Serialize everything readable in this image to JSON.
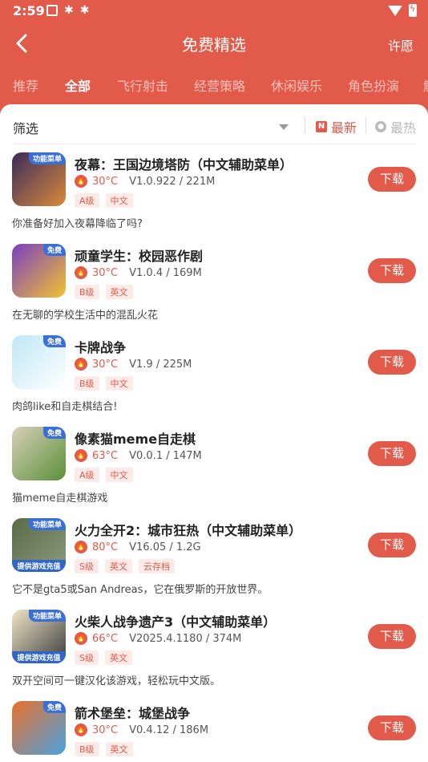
{
  "status_bar": {
    "time": "2:59"
  },
  "header": {
    "title": "免费精选",
    "wish_label": "许愿"
  },
  "tabs": [
    "推荐",
    "全部",
    "飞行射击",
    "经营策略",
    "休闲娱乐",
    "角色扮演",
    "解"
  ],
  "active_tab": "全部",
  "filter": {
    "label": "筛选",
    "sort_latest": "最新",
    "sort_hot": "最热"
  },
  "download_label": "下载",
  "games": [
    {
      "title": "夜幕：王国边境塔防（中文辅助菜单）",
      "temp": "30°C",
      "version": "V1.0.922 / 221M",
      "tags": [
        "A级",
        "中文"
      ],
      "desc": "你准备好加入夜幕降临了吗?",
      "badge": "功能菜单",
      "badge_bottom": "",
      "icon": "night-defense-icon",
      "colors": [
        "#3b2a5c",
        "#d98a3a"
      ]
    },
    {
      "title": "顽童学生：校园恶作剧",
      "temp": "30°C",
      "version": "V1.0.4 / 169M",
      "tags": [
        "B级",
        "英文"
      ],
      "desc": "在无聊的学校生活中的混乱火花",
      "badge": "免费",
      "badge_bottom": "",
      "icon": "prank-student-icon",
      "colors": [
        "#7a3fc2",
        "#f2c230"
      ]
    },
    {
      "title": "卡牌战争",
      "temp": "30°C",
      "version": "V1.9 / 225M",
      "tags": [
        "B级",
        "中文"
      ],
      "desc": "肉鸽like和自走棋结合!",
      "badge": "免费",
      "badge_bottom": "",
      "icon": "card-war-icon",
      "colors": [
        "#bfe8f7",
        "#ffffff"
      ]
    },
    {
      "title": "像素猫meme自走棋",
      "temp": "63°C",
      "version": "V0.0.1 / 147M",
      "tags": [
        "A级",
        "中文"
      ],
      "desc": "猫meme自走棋游戏",
      "badge": "免费",
      "badge_bottom": "",
      "icon": "pixel-cat-icon",
      "colors": [
        "#d8d0b8",
        "#5b8f3a"
      ]
    },
    {
      "title": "火力全开2：城市狂热（中文辅助菜单）",
      "temp": "80°C",
      "version": "V16.05 / 1.2G",
      "tags": [
        "S级",
        "英文",
        "云存档"
      ],
      "desc": "它不是gta5或San Andreas，它在俄罗斯的开放世界。",
      "badge": "功能菜单",
      "badge_bottom": "提供游戏充值",
      "icon": "full-fire-icon",
      "colors": [
        "#5a6b4a",
        "#8a9a7a"
      ]
    },
    {
      "title": "火柴人战争遗产3（中文辅助菜单）",
      "temp": "66°C",
      "version": "V2025.4.1180 / 374M",
      "tags": [
        "S级",
        "英文"
      ],
      "desc": "双开空间可一键汉化该游戏，轻松玩中文版。",
      "badge": "功能菜单",
      "badge_bottom": "提供游戏充值",
      "icon": "stick-war-icon",
      "colors": [
        "#f0e6c8",
        "#3a3a3a"
      ]
    },
    {
      "title": "箭术堡垒：城堡战争",
      "temp": "30°C",
      "version": "V0.4.12 / 186M",
      "tags": [
        "B级",
        "英文"
      ],
      "desc": "",
      "badge": "免费",
      "badge_bottom": "",
      "icon": "archery-castle-icon",
      "colors": [
        "#e8702a",
        "#4aa3df"
      ]
    }
  ]
}
